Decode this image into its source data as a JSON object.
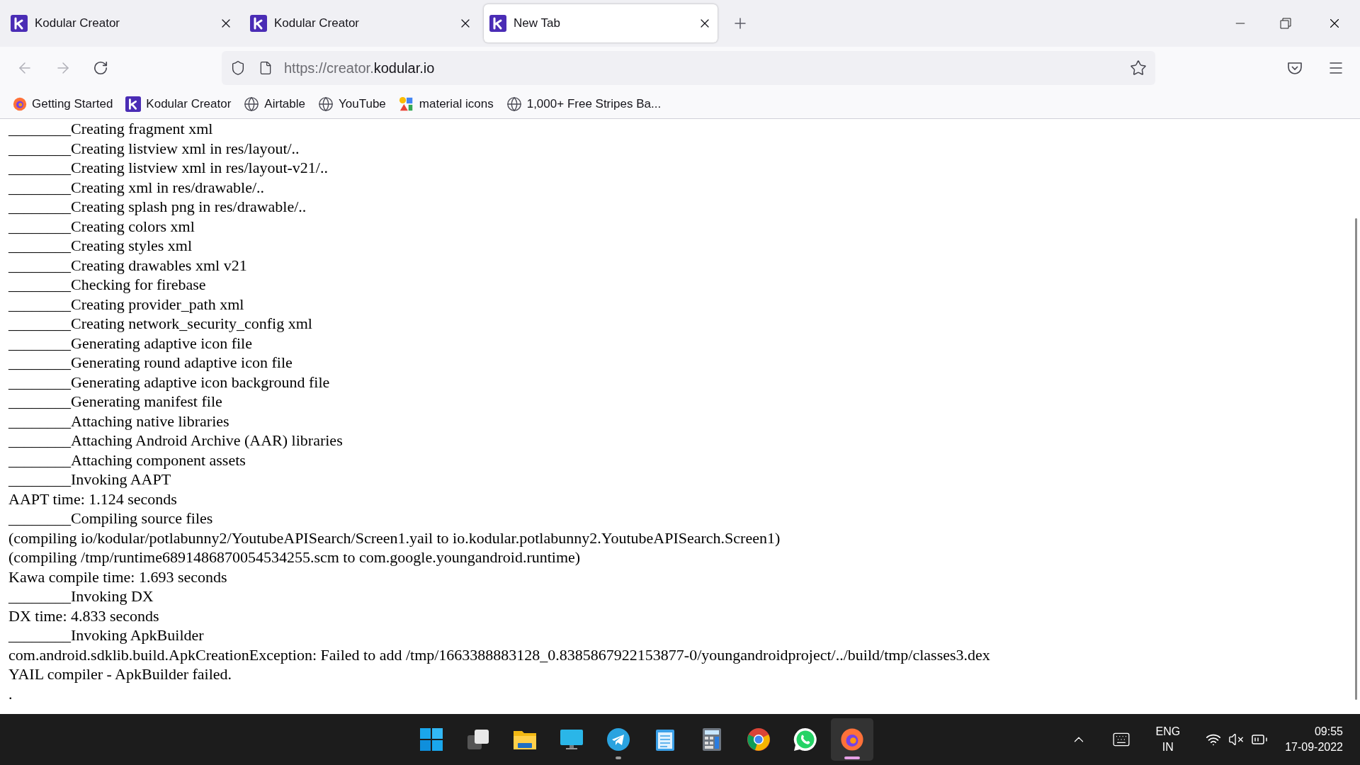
{
  "tabs": [
    {
      "title": "Kodular Creator",
      "selected": false
    },
    {
      "title": "Kodular Creator",
      "selected": false
    },
    {
      "title": "New Tab",
      "selected": true
    }
  ],
  "address_bar": {
    "url_prefix": "https://creator.",
    "url_domain": "kodular.io"
  },
  "bookmarks": [
    {
      "label": "Getting Started",
      "kind": "firefox"
    },
    {
      "label": "Kodular Creator",
      "kind": "kodular"
    },
    {
      "label": "Airtable",
      "kind": "globe"
    },
    {
      "label": "YouTube",
      "kind": "globe"
    },
    {
      "label": "material icons",
      "kind": "material"
    },
    {
      "label": "1,000+ Free Stripes Ba...",
      "kind": "globe"
    }
  ],
  "log_lines": [
    "________Creating fragment xml",
    "________Creating listview xml in res/layout/..",
    "________Creating listview xml in res/layout-v21/..",
    "________Creating xml in res/drawable/..",
    "________Creating splash png in res/drawable/..",
    "________Creating colors xml",
    "________Creating styles xml",
    "________Creating drawables xml v21",
    "________Checking for firebase",
    "________Creating provider_path xml",
    "________Creating network_security_config xml",
    "________Generating adaptive icon file",
    "________Generating round adaptive icon file",
    "________Generating adaptive icon background file",
    "________Generating manifest file",
    "________Attaching native libraries",
    "________Attaching Android Archive (AAR) libraries",
    "________Attaching component assets",
    "________Invoking AAPT",
    "AAPT time: 1.124 seconds",
    "________Compiling source files",
    "(compiling io/kodular/potlabunny2/YoutubeAPISearch/Screen1.yail to io.kodular.potlabunny2.YoutubeAPISearch.Screen1)",
    "(compiling /tmp/runtime6891486870054534255.scm to com.google.youngandroid.runtime)",
    "Kawa compile time: 1.693 seconds",
    "________Invoking DX",
    "DX time: 4.833 seconds",
    "________Invoking ApkBuilder",
    "com.android.sdklib.build.ApkCreationException: Failed to add /tmp/1663388883128_0.8385867922153877-0/youngandroidproject/../build/tmp/classes3.dex",
    "YAIL compiler - ApkBuilder failed.",
    "."
  ],
  "taskbar": {
    "apps": [
      {
        "kind": "start",
        "running": false,
        "selected": false
      },
      {
        "kind": "taskview",
        "running": false,
        "selected": false
      },
      {
        "kind": "folder",
        "running": false,
        "selected": false
      },
      {
        "kind": "monitor",
        "running": false,
        "selected": false
      },
      {
        "kind": "telegram",
        "running": true,
        "selected": false
      },
      {
        "kind": "notepad",
        "running": false,
        "selected": false
      },
      {
        "kind": "calculator",
        "running": false,
        "selected": false
      },
      {
        "kind": "chrome",
        "running": false,
        "selected": false
      },
      {
        "kind": "whatsapp",
        "running": false,
        "selected": false
      },
      {
        "kind": "firefox",
        "running": true,
        "selected": true
      }
    ],
    "language": "ENG",
    "region": "IN",
    "time": "09:55",
    "date": "17-09-2022"
  }
}
